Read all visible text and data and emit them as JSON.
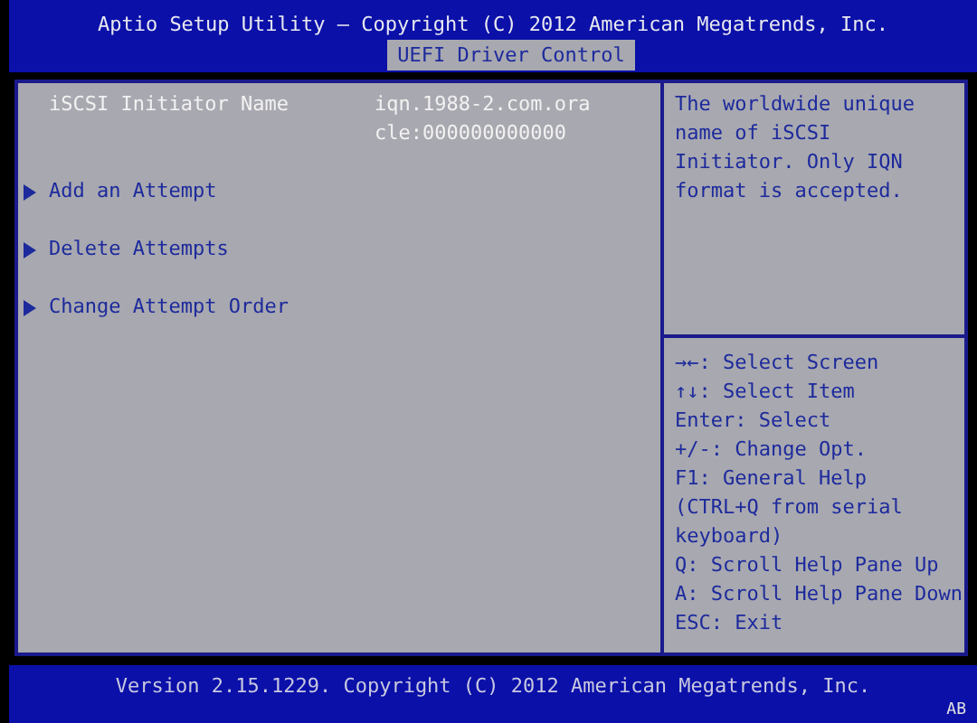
{
  "header": {
    "title": "Aptio Setup Utility – Copyright (C) 2012 American Megatrends, Inc.",
    "tabs": [
      {
        "label": "UEFI Driver Control",
        "selected": true
      }
    ]
  },
  "settings": [
    {
      "kind": "info",
      "label": "iSCSI Initiator Name",
      "value_lines": [
        "iqn.1988-2.com.ora",
        "cle:000000000000"
      ]
    },
    {
      "kind": "submenu",
      "label": "Add an Attempt"
    },
    {
      "kind": "submenu",
      "label": "Delete Attempts"
    },
    {
      "kind": "submenu",
      "label": "Change Attempt Order"
    }
  ],
  "help": {
    "description_lines": [
      "The worldwide unique",
      "name of iSCSI",
      "Initiator. Only IQN",
      "format is accepted."
    ],
    "keys": [
      "→←: Select Screen",
      "↑↓: Select Item",
      "Enter: Select",
      "+/-: Change Opt.",
      "F1: General Help",
      "(CTRL+Q from serial",
      "keyboard)",
      "Q: Scroll Help Pane Up",
      "A: Scroll Help Pane Down",
      "ESC: Exit"
    ]
  },
  "footer": {
    "version": "Version 2.15.1229. Copyright (C) 2012 American Megatrends, Inc.",
    "corner": "AB"
  }
}
